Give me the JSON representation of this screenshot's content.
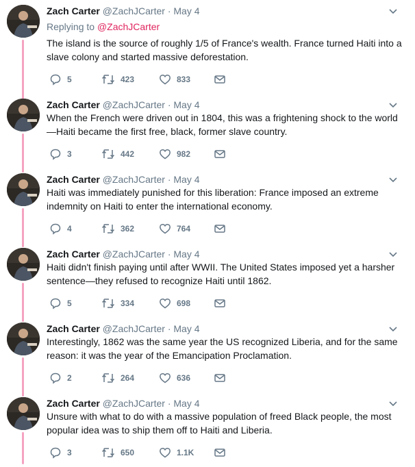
{
  "colors": {
    "thread_line": "#f4a3c0",
    "name": "#14171a",
    "secondary": "#657786",
    "mention": "#e0245e"
  },
  "icons": {
    "reply": "reply-icon",
    "retweet": "retweet-icon",
    "like": "heart-icon",
    "dm": "envelope-icon",
    "caret": "chevron-down-icon"
  },
  "tweets": [
    {
      "name": "Zach Carter",
      "handle": "@ZachJCarter",
      "dot": "·",
      "date": "May 4",
      "replying_prefix": "Replying to",
      "replying_to": "@ZachJCarter",
      "text": "The island is the source of roughly 1/5 of France's wealth. France turned Haiti into a slave colony and started massive deforestation.",
      "replies": "5",
      "retweets": "423",
      "likes": "833"
    },
    {
      "name": "Zach Carter",
      "handle": "@ZachJCarter",
      "dot": "·",
      "date": "May 4",
      "text": "When the French were driven out in 1804, this was a frightening shock to the world—Haiti became the first free, black, former slave country.",
      "replies": "3",
      "retweets": "442",
      "likes": "982"
    },
    {
      "name": "Zach Carter",
      "handle": "@ZachJCarter",
      "dot": "·",
      "date": "May 4",
      "text": "Haiti was immediately punished for this liberation: France imposed an extreme indemnity on Haiti to enter the international economy.",
      "replies": "4",
      "retweets": "362",
      "likes": "764"
    },
    {
      "name": "Zach Carter",
      "handle": "@ZachJCarter",
      "dot": "·",
      "date": "May 4",
      "text": "Haiti didn't finish paying until after WWII. The United States imposed yet a harsher sentence—they refused to recognize Haiti until 1862.",
      "replies": "5",
      "retweets": "334",
      "likes": "698"
    },
    {
      "name": "Zach Carter",
      "handle": "@ZachJCarter",
      "dot": "·",
      "date": "May 4",
      "text": "Interestingly, 1862 was the same year the US recognized Liberia, and for the same reason: it was the year of the Emancipation Proclamation.",
      "replies": "2",
      "retweets": "264",
      "likes": "636"
    },
    {
      "name": "Zach Carter",
      "handle": "@ZachJCarter",
      "dot": "·",
      "date": "May 4",
      "text": "Unsure with what to do with a massive population of freed Black people, the most popular idea was to ship them off to Haiti and Liberia.",
      "replies": "3",
      "retweets": "650",
      "likes": "1.1K"
    }
  ]
}
